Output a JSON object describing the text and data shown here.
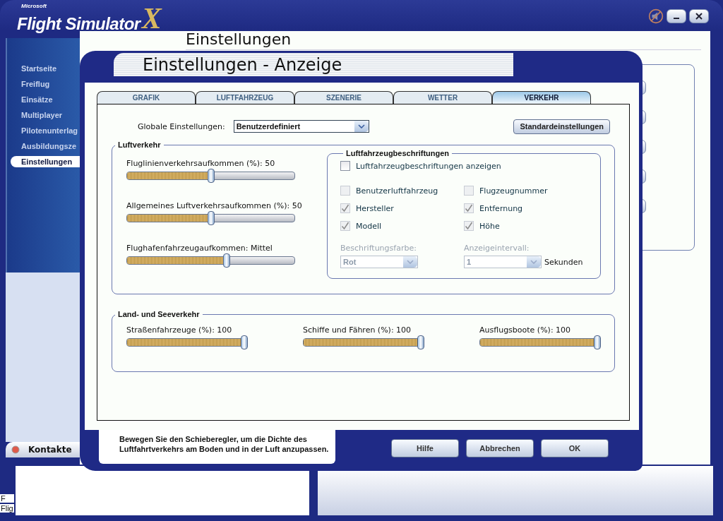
{
  "app": {
    "logo": {
      "brand": "Microsoft",
      "product": "Flight Simulator",
      "mark": "X"
    },
    "page_title": "Einstellungen",
    "nav": [
      {
        "label": "Startseite",
        "selected": false
      },
      {
        "label": "Freiflug",
        "selected": false
      },
      {
        "label": "Einsätze",
        "selected": false
      },
      {
        "label": "Multiplayer",
        "selected": false
      },
      {
        "label": "Pilotenunterlag",
        "selected": false
      },
      {
        "label": "Ausbildungsze",
        "selected": false
      },
      {
        "label": "Einstellungen",
        "selected": true
      }
    ],
    "contacts_tab": "Kontakte"
  },
  "desktop_items": [
    "F",
    "Flig"
  ],
  "dialog": {
    "title": "Einstellungen - Anzeige",
    "tabs": [
      {
        "label": "GRAFIK",
        "selected": false
      },
      {
        "label": "LUFTFAHRZEUG",
        "selected": false
      },
      {
        "label": "SZENERIE",
        "selected": false
      },
      {
        "label": "WETTER",
        "selected": false
      },
      {
        "label": "VERKEHR",
        "selected": true
      }
    ],
    "global": {
      "label": "Globale Einstellungen:",
      "value": "Benutzerdefiniert"
    },
    "defaults_button": "Standardeinstellungen",
    "air": {
      "title": "Luftverkehr",
      "sliders": [
        {
          "label": "Fluglinienverkehrsaufkommen (%): 50",
          "level": 0.5
        },
        {
          "label": "Allgemeines Luftverkehrsaufkommen (%): 50",
          "level": 0.5
        },
        {
          "label": "Flughafenfahrzeugaufkommen: Mittel",
          "level": 0.6
        }
      ]
    },
    "labels": {
      "title": "Luftfahrzeugbeschriftungen",
      "show": {
        "label": "Luftfahrzeugbeschriftungen anzeigen",
        "checked": false
      },
      "options": [
        {
          "label": "Benutzerluftfahrzeug",
          "checked": false,
          "disabled": true
        },
        {
          "label": "Flugzeugnummer",
          "checked": false,
          "disabled": true
        },
        {
          "label": "Hersteller",
          "checked": true,
          "disabled": true
        },
        {
          "label": "Entfernung",
          "checked": true,
          "disabled": true
        },
        {
          "label": "Modell",
          "checked": true,
          "disabled": true
        },
        {
          "label": "Höhe",
          "checked": true,
          "disabled": true
        }
      ],
      "color": {
        "label": "Beschriftungsfarbe:",
        "value": "Rot",
        "disabled": true
      },
      "interval": {
        "label": "Anzeigeintervall:",
        "value": "1",
        "unit": "Sekunden",
        "disabled": true
      }
    },
    "ground": {
      "title": "Land- und Seeverkehr",
      "sliders": [
        {
          "label": "Straßenfahrzeuge (%): 100",
          "level": 1
        },
        {
          "label": "Schiffe und Fähren (%): 100",
          "level": 1
        },
        {
          "label": "Ausflugsboote (%): 100",
          "level": 1
        }
      ]
    },
    "help_text": "Bewegen Sie den Schieberegler, um die Dichte des Luftfahrtverkehrs am Boden und in der Luft anzupassen.",
    "buttons": [
      "Hilfe",
      "Abbrechen",
      "OK"
    ]
  }
}
